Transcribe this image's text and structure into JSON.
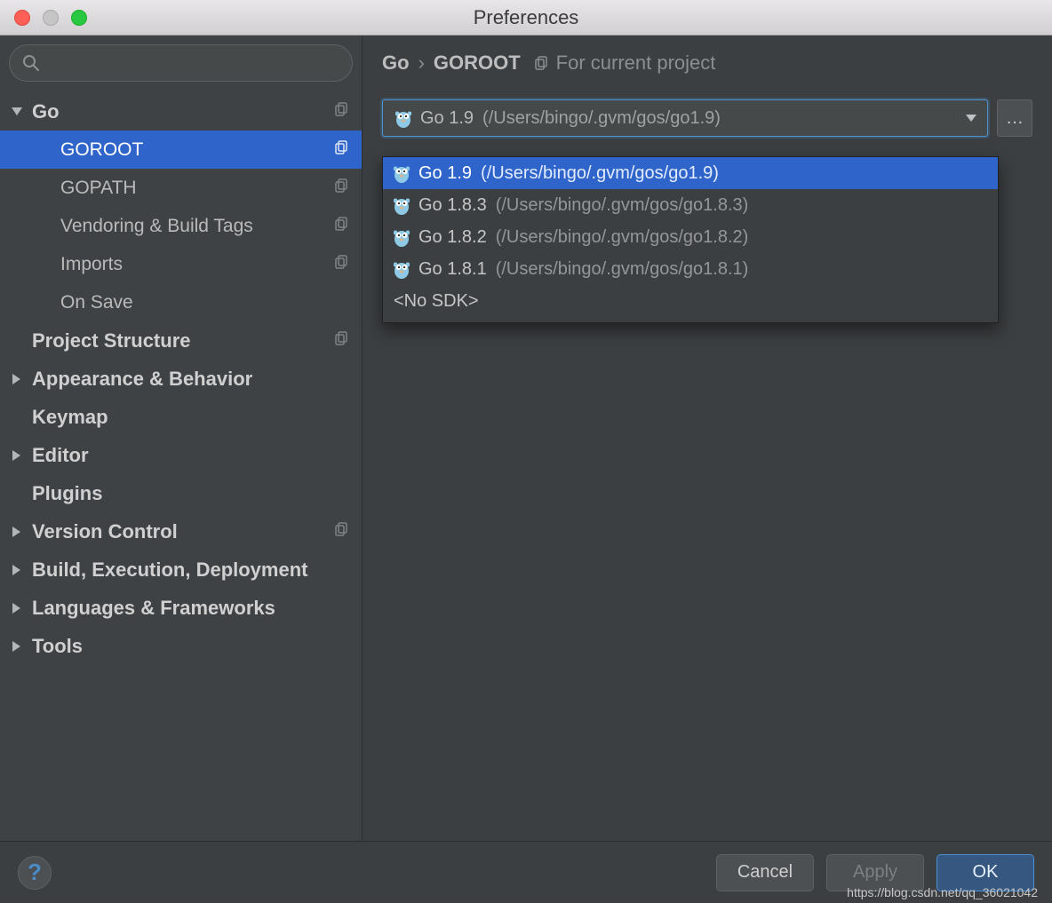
{
  "window": {
    "title": "Preferences"
  },
  "search": {
    "placeholder": ""
  },
  "sidebar": {
    "items": [
      {
        "label": "Go",
        "bold": true,
        "arrow": "down",
        "indent": 0,
        "copy": true,
        "selected": false
      },
      {
        "label": "GOROOT",
        "bold": false,
        "arrow": "",
        "indent": 1,
        "copy": true,
        "selected": true
      },
      {
        "label": "GOPATH",
        "bold": false,
        "arrow": "",
        "indent": 1,
        "copy": true,
        "selected": false
      },
      {
        "label": "Vendoring & Build Tags",
        "bold": false,
        "arrow": "",
        "indent": 1,
        "copy": true,
        "selected": false
      },
      {
        "label": "Imports",
        "bold": false,
        "arrow": "",
        "indent": 1,
        "copy": true,
        "selected": false
      },
      {
        "label": "On Save",
        "bold": false,
        "arrow": "",
        "indent": 1,
        "copy": false,
        "selected": false
      },
      {
        "label": "Project Structure",
        "bold": true,
        "arrow": "",
        "indent": 0,
        "copy": true,
        "selected": false
      },
      {
        "label": "Appearance & Behavior",
        "bold": true,
        "arrow": "right",
        "indent": 0,
        "copy": false,
        "selected": false
      },
      {
        "label": "Keymap",
        "bold": true,
        "arrow": "",
        "indent": 0,
        "copy": false,
        "selected": false
      },
      {
        "label": "Editor",
        "bold": true,
        "arrow": "right",
        "indent": 0,
        "copy": false,
        "selected": false
      },
      {
        "label": "Plugins",
        "bold": true,
        "arrow": "",
        "indent": 0,
        "copy": false,
        "selected": false
      },
      {
        "label": "Version Control",
        "bold": true,
        "arrow": "right",
        "indent": 0,
        "copy": true,
        "selected": false
      },
      {
        "label": "Build, Execution, Deployment",
        "bold": true,
        "arrow": "right",
        "indent": 0,
        "copy": false,
        "selected": false
      },
      {
        "label": "Languages & Frameworks",
        "bold": true,
        "arrow": "right",
        "indent": 0,
        "copy": false,
        "selected": false
      },
      {
        "label": "Tools",
        "bold": true,
        "arrow": "right",
        "indent": 0,
        "copy": false,
        "selected": false
      }
    ]
  },
  "breadcrumb": {
    "root": "Go",
    "sep": "›",
    "page": "GOROOT",
    "scope": "For current project"
  },
  "combo": {
    "name": "Go 1.9",
    "path": "(/Users/bingo/.gvm/gos/go1.9)"
  },
  "browse_label": "…",
  "dropdown": {
    "items": [
      {
        "name": "Go 1.9",
        "path": "(/Users/bingo/.gvm/gos/go1.9)",
        "selected": true
      },
      {
        "name": "Go 1.8.3",
        "path": "(/Users/bingo/.gvm/gos/go1.8.3)",
        "selected": false
      },
      {
        "name": "Go 1.8.2",
        "path": "(/Users/bingo/.gvm/gos/go1.8.2)",
        "selected": false
      },
      {
        "name": "Go 1.8.1",
        "path": "(/Users/bingo/.gvm/gos/go1.8.1)",
        "selected": false
      }
    ],
    "no_sdk": "<No SDK>"
  },
  "footer": {
    "help": "?",
    "cancel": "Cancel",
    "apply": "Apply",
    "ok": "OK"
  },
  "watermark": "https://blog.csdn.net/qq_36021042"
}
